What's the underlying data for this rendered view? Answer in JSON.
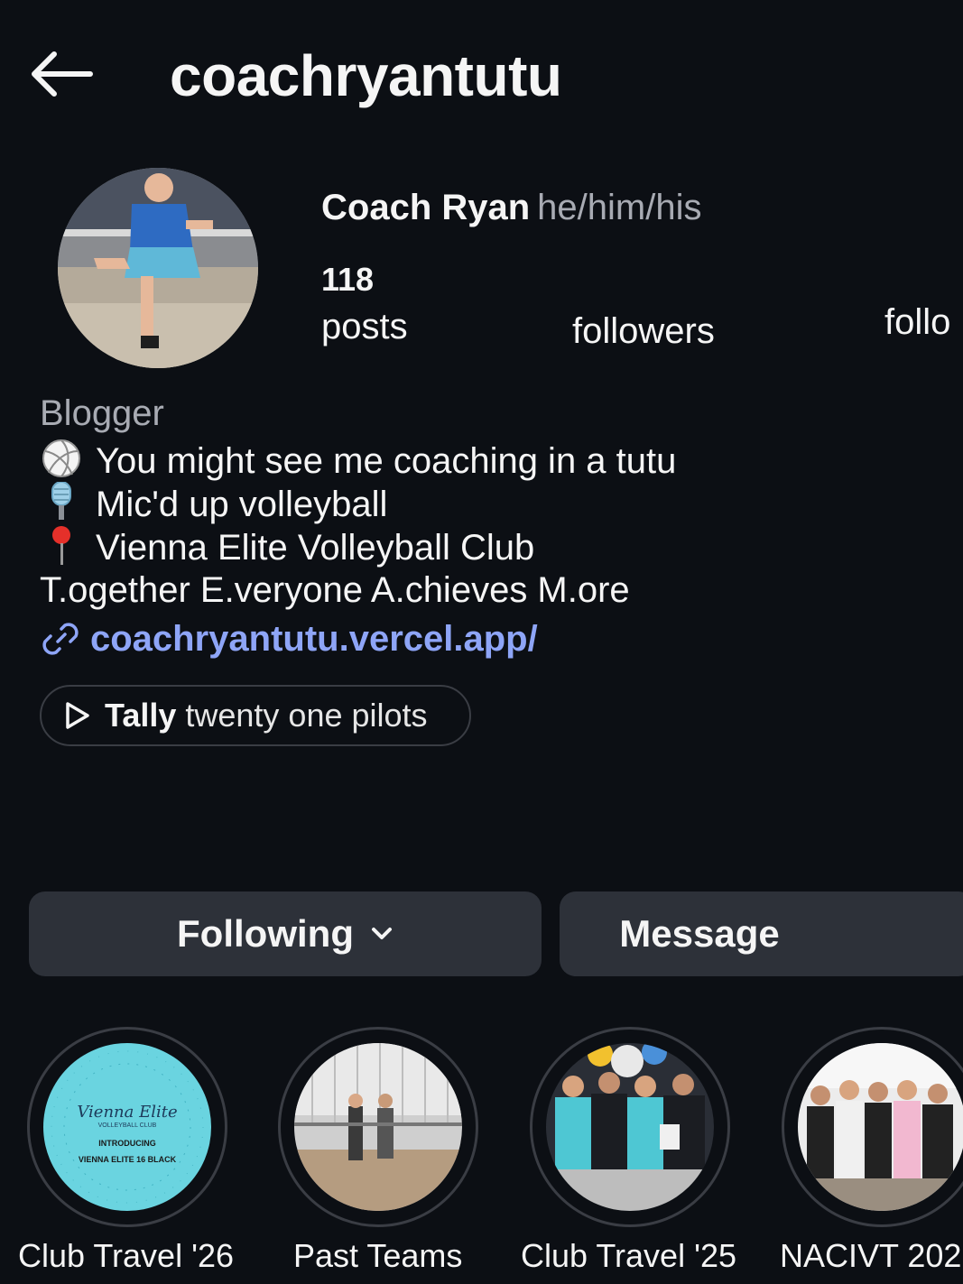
{
  "header": {
    "username": "coachryantutu",
    "back_icon": "arrow-left-icon"
  },
  "profile": {
    "display_name": "Coach Ryan",
    "pronouns": "he/him/his",
    "avatar": "avatar-photo"
  },
  "stats": {
    "posts_count": "118",
    "posts_label": "posts",
    "followers_label": "followers",
    "following_label": "follo"
  },
  "bio": {
    "category": "Blogger",
    "lines": [
      {
        "icon": "volleyball-icon",
        "text": "You might see me coaching in a tutu"
      },
      {
        "icon": "microphone-icon",
        "text": "Mic'd up volleyball"
      },
      {
        "icon": "pin-icon",
        "text": "Vienna Elite Volleyball Club"
      }
    ],
    "motto": "T.ogether E.veryone A.chieves M.ore",
    "link_icon": "link-icon",
    "link_text": "coachryantutu.vercel.app/"
  },
  "music": {
    "icon": "play-icon",
    "song": "Tally",
    "artist": "twenty one pilots"
  },
  "actions": {
    "following_label": "Following",
    "following_icon": "chevron-down-icon",
    "message_label": "Message"
  },
  "highlights": [
    {
      "label": "Club Travel '26",
      "cover": {
        "title": "Vienna Elite",
        "subtitle": "VOLLEYBALL CLUB",
        "line1": "INTRODUCING",
        "line2": "VIENNA ELITE 16 BLACK"
      }
    },
    {
      "label": "Past Teams"
    },
    {
      "label": "Club Travel '25"
    },
    {
      "label": "NACIVT 202"
    }
  ],
  "colors": {
    "background": "#0c0f14",
    "button": "#2d3139",
    "link": "#8ea5f7",
    "muted": "#a8abb3"
  }
}
